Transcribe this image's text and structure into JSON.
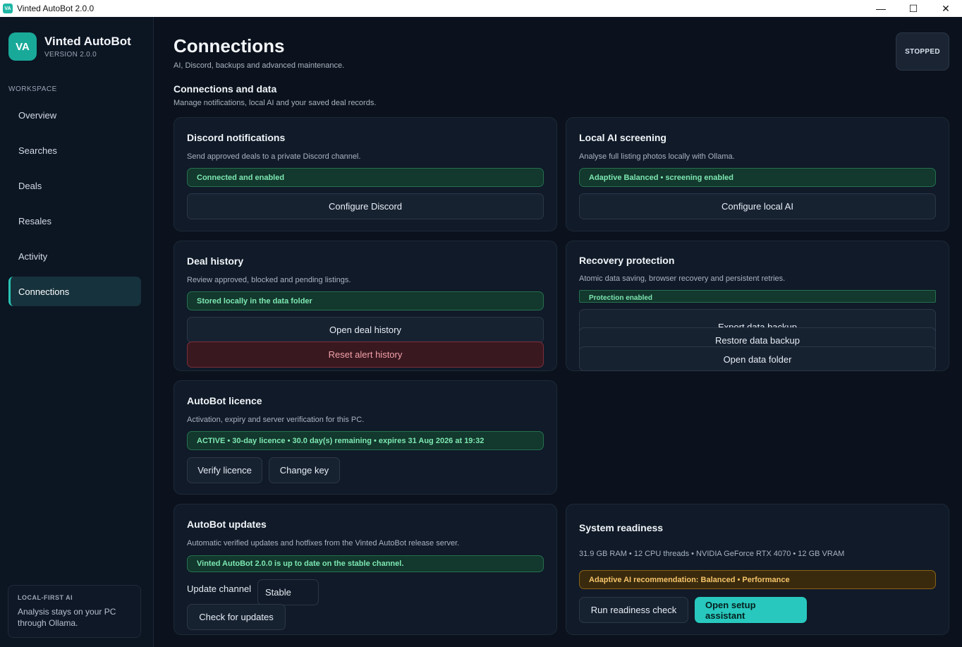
{
  "window": {
    "title": "Vinted AutoBot 2.0.0",
    "app_icon": "VA",
    "minimize": "—",
    "maximize": "☐",
    "close": "✕"
  },
  "sidebar": {
    "logo": "VA",
    "app_name": "Vinted AutoBot",
    "version": "VERSION 2.0.0",
    "section_label": "WORKSPACE",
    "items": [
      {
        "label": "Overview"
      },
      {
        "label": "Searches"
      },
      {
        "label": "Deals"
      },
      {
        "label": "Resales"
      },
      {
        "label": "Activity"
      },
      {
        "label": "Connections",
        "active": true
      }
    ],
    "footer": {
      "title": "LOCAL-FIRST AI",
      "text": "Analysis stays on your PC through Ollama."
    }
  },
  "header": {
    "title": "Connections",
    "subtitle": "AI, Discord, backups and advanced maintenance.",
    "status": "STOPPED"
  },
  "section": {
    "title": "Connections and data",
    "subtitle": "Manage notifications, local AI and your saved deal records."
  },
  "cards": {
    "discord": {
      "title": "Discord notifications",
      "desc": "Send approved deals to a private Discord channel.",
      "badge": "Connected and enabled",
      "button": "Configure Discord"
    },
    "local_ai": {
      "title": "Local AI screening",
      "desc": "Analyse full listing photos locally with Ollama.",
      "badge": "Adaptive Balanced • screening enabled",
      "button": "Configure local AI"
    },
    "deal_history": {
      "title": "Deal history",
      "desc": "Review approved, blocked and pending listings.",
      "badge": "Stored locally in the data folder",
      "open_button": "Open deal history",
      "reset_button": "Reset alert history"
    },
    "recovery": {
      "title": "Recovery protection",
      "desc": "Atomic data saving, browser recovery and persistent retries.",
      "badge": "Protection enabled",
      "export_button": "Export data backup",
      "restore_button": "Restore data backup",
      "open_folder_button": "Open data folder"
    },
    "licence": {
      "title": "AutoBot licence",
      "desc": "Activation, expiry and server verification for this PC.",
      "badge": "ACTIVE • 30-day licence • 30.0 day(s) remaining • expires 31 Aug 2026 at 19:32",
      "verify_button": "Verify licence",
      "change_button": "Change key"
    },
    "updates": {
      "title": "AutoBot updates",
      "desc": "Automatic verified updates and hotfixes from the Vinted AutoBot release server.",
      "badge": "Vinted AutoBot 2.0.0 is up to date on the stable channel.",
      "channel_label": "Update channel",
      "channel_value": "Stable",
      "check_button": "Check for updates"
    },
    "system": {
      "title": "System readiness",
      "specs": "31.9 GB RAM • 12 CPU threads • NVIDIA GeForce RTX 4070 • 12 GB VRAM",
      "badge": "Adaptive AI recommendation: Balanced • Performance",
      "run_button": "Run readiness check",
      "setup_button": "Open setup assistant"
    }
  },
  "colors": {
    "accent": "#28c8be",
    "success": "#7de8b2",
    "warning": "#f6c56a",
    "danger": "#f3a1a8",
    "background": "#0b121d"
  }
}
